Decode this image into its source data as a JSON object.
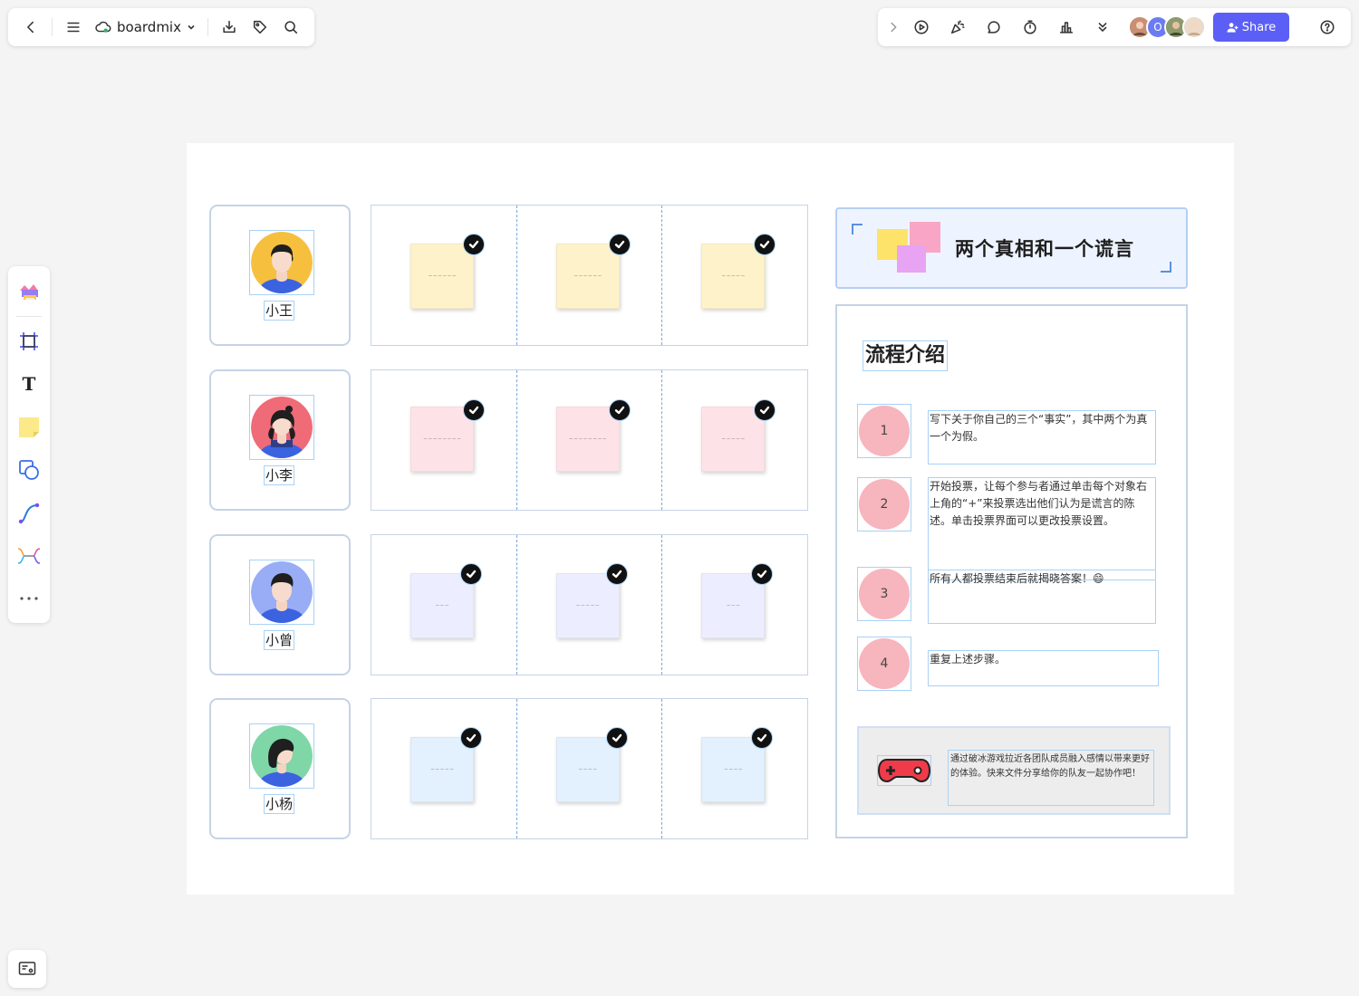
{
  "toolbar_left": {
    "doc_name": "boardmix"
  },
  "toolbar_right": {
    "share_label": "Share",
    "collaborator_initial": "O"
  },
  "board": {
    "title": "两个真相和一个谎言",
    "participants": [
      "小王",
      "小李",
      "小曾",
      "小杨"
    ],
    "process_title": "流程介绍",
    "steps": [
      {
        "num": "1",
        "text": "写下关于你自己的三个“事实”，其中两个为真一个为假。"
      },
      {
        "num": "2",
        "text": "开始投票，让每个参与者通过单击每个对象右上角的“+”来投票选出他们认为是谎言的陈述。单击投票界面可以更改投票设置。"
      },
      {
        "num": "3",
        "text": "所有人都投票结束后就揭晓答案！😄"
      },
      {
        "num": "4",
        "text": "重复上述步骤。"
      }
    ],
    "tip": "通过破冰游戏拉近各团队成员融入感情以带来更好的体验。快来文件分享给你的队友一起协作吧！"
  },
  "colors": {
    "accent": "#5b5ff5",
    "sticky_yellow": "#fdf2c9",
    "sticky_pink": "#fde3e7",
    "sticky_lavender": "#eceeff",
    "sticky_blue": "#e3f0fd",
    "step_circle": "#f7b5bd"
  }
}
